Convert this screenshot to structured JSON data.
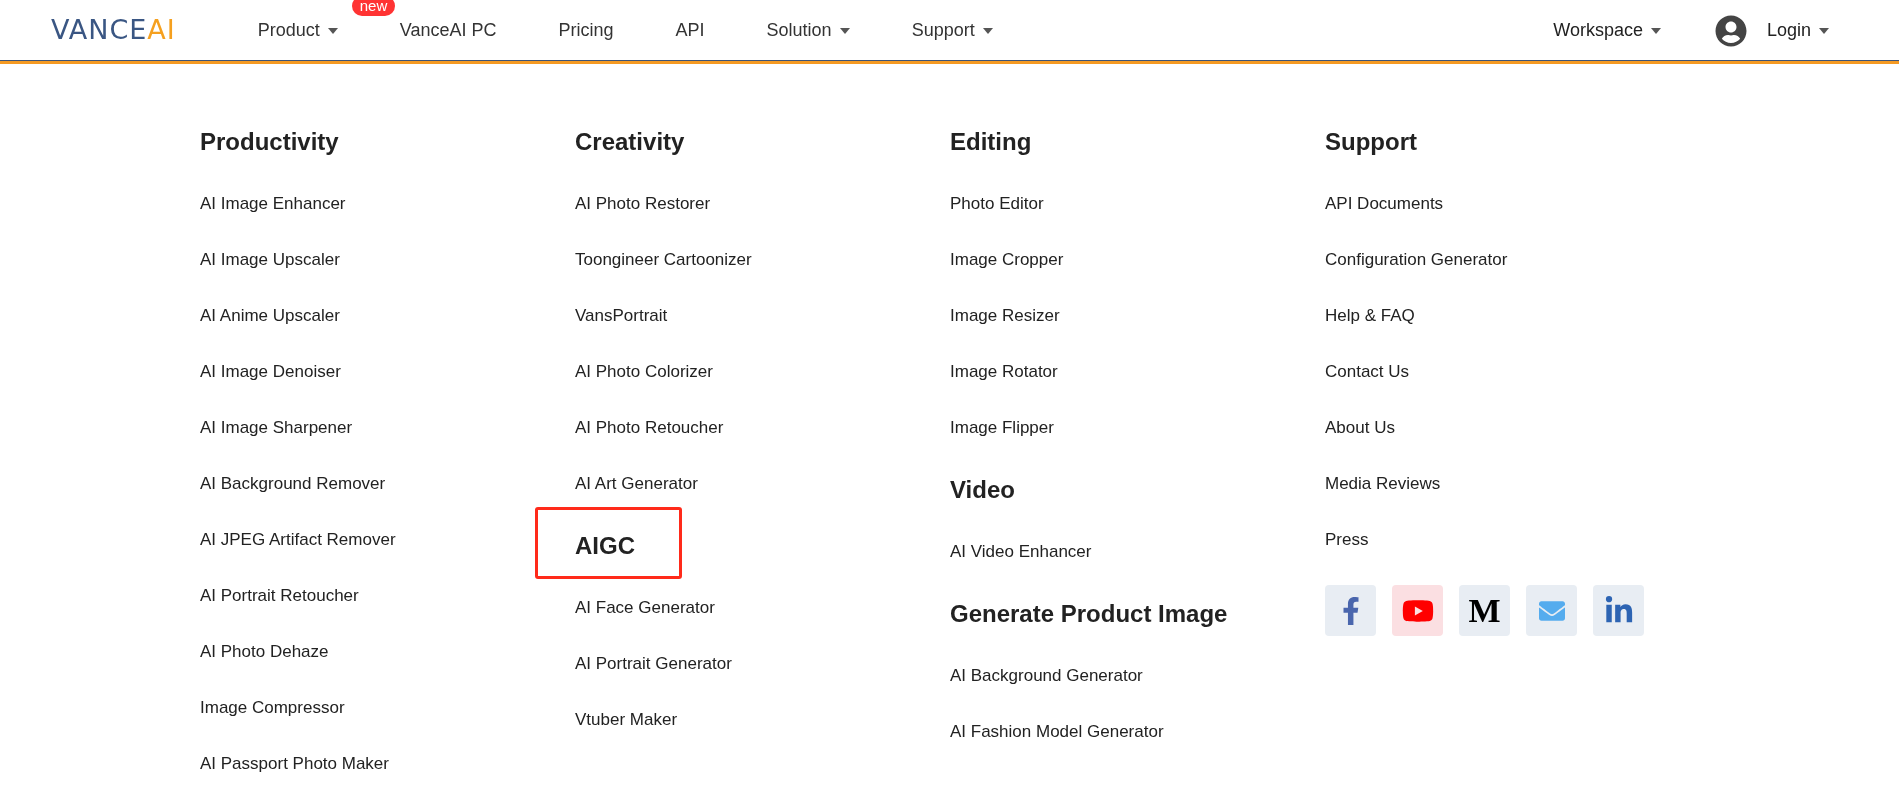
{
  "header": {
    "logo": {
      "main": "VANCE",
      "accent": "AI"
    },
    "nav": [
      {
        "label": "Product",
        "caret": true,
        "badge": "new"
      },
      {
        "label": "VanceAI PC",
        "caret": false
      },
      {
        "label": "Pricing",
        "caret": false
      },
      {
        "label": "API",
        "caret": false
      },
      {
        "label": "Solution",
        "caret": true
      },
      {
        "label": "Support",
        "caret": true
      }
    ],
    "right": [
      {
        "label": "Workspace",
        "caret": true,
        "avatar": false
      },
      {
        "label": "Login",
        "caret": true,
        "avatar": true
      }
    ]
  },
  "columns": [
    {
      "sections": [
        {
          "heading": "Productivity",
          "highlighted": false,
          "items": [
            "AI Image Enhancer",
            "AI Image Upscaler",
            "AI Anime Upscaler",
            "AI Image Denoiser",
            "AI Image Sharpener",
            "AI Background Remover",
            "AI JPEG Artifact Remover",
            "AI Portrait Retoucher",
            "AI Photo Dehaze",
            "Image Compressor",
            "AI Passport Photo Maker"
          ]
        }
      ]
    },
    {
      "sections": [
        {
          "heading": "Creativity",
          "highlighted": false,
          "items": [
            "AI Photo Restorer",
            "Toongineer Cartoonizer",
            "VansPortrait",
            "AI Photo Colorizer",
            "AI Photo Retoucher",
            "AI Art Generator"
          ]
        },
        {
          "heading": "AIGC",
          "highlighted": true,
          "items": [
            "AI Face Generator",
            "AI Portrait Generator",
            "Vtuber Maker"
          ]
        }
      ]
    },
    {
      "sections": [
        {
          "heading": "Editing",
          "highlighted": false,
          "items": [
            "Photo Editor",
            "Image Cropper",
            "Image Resizer",
            "Image Rotator",
            "Image Flipper"
          ]
        },
        {
          "heading": "Video",
          "highlighted": false,
          "items": [
            "AI Video Enhancer"
          ]
        },
        {
          "heading": "Generate Product Image",
          "highlighted": false,
          "items": [
            "AI Background Generator",
            "AI Fashion Model Generator"
          ]
        }
      ]
    },
    {
      "sections": [
        {
          "heading": "Support",
          "highlighted": false,
          "items": [
            "API Documents",
            "Configuration Generator",
            "Help & FAQ",
            "Contact Us",
            "About Us",
            "Media Reviews",
            "Press"
          ]
        }
      ],
      "social": [
        {
          "kind": "facebook"
        },
        {
          "kind": "youtube"
        },
        {
          "kind": "medium",
          "glyph": "M"
        },
        {
          "kind": "mail"
        },
        {
          "kind": "linkedin"
        }
      ]
    }
  ]
}
